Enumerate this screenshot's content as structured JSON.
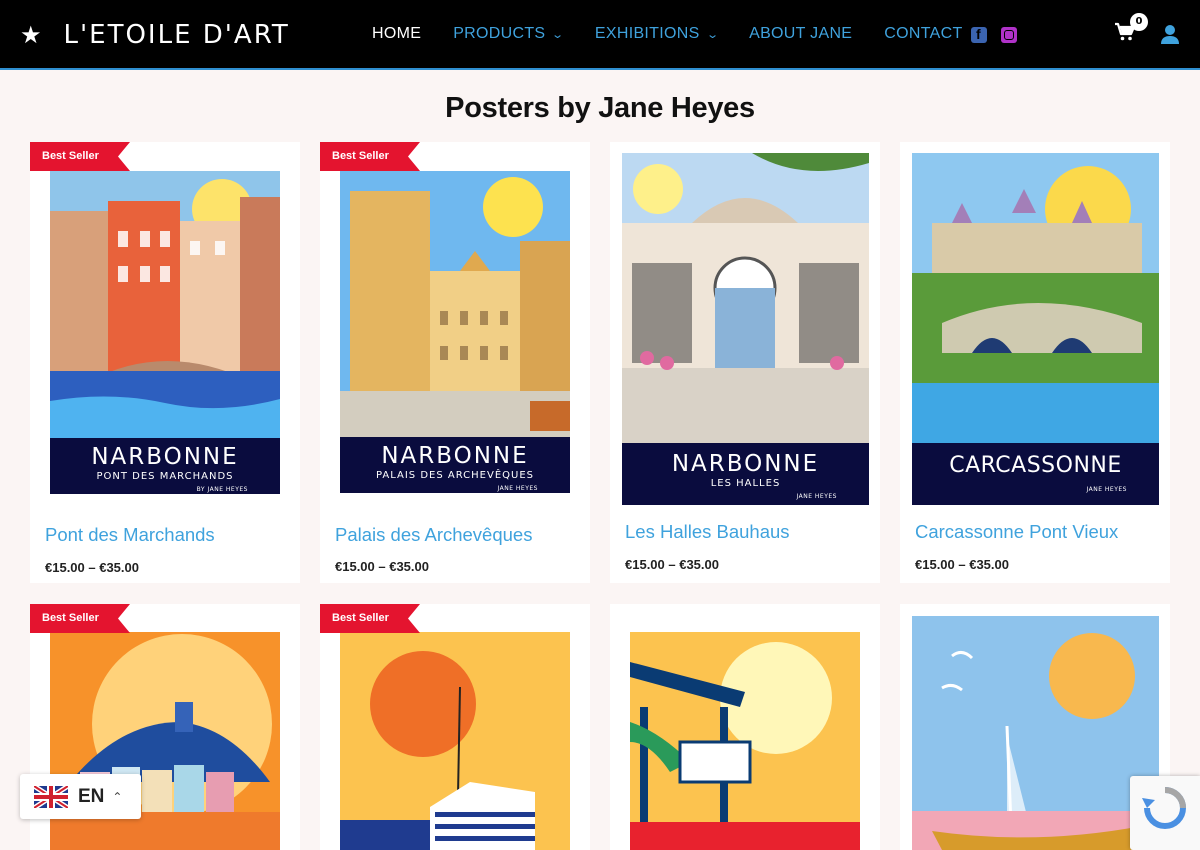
{
  "header": {
    "logo_text": "L'ETOILE D'ART",
    "nav": [
      {
        "label": "HOME",
        "active": true
      },
      {
        "label": "PRODUCTS",
        "dropdown": true
      },
      {
        "label": "EXHIBITIONS",
        "dropdown": true
      },
      {
        "label": "ABOUT JANE"
      },
      {
        "label": "CONTACT"
      }
    ],
    "cart_count": "0",
    "icons": [
      "star-icon",
      "facebook-icon",
      "instagram-icon",
      "cart-icon",
      "user-icon"
    ]
  },
  "page_title": "Posters by Jane Heyes",
  "products": [
    {
      "name": "Pont des Marchands",
      "price": "€15.00 – €35.00",
      "badge": "Best Seller",
      "poster_city": "NARBONNE",
      "poster_sub": "PONT DES MARCHANDS",
      "poster_author": "BY JANE HEYES"
    },
    {
      "name": "Palais des Archevêques",
      "price": "€15.00 – €35.00",
      "badge": "Best Seller",
      "poster_city": "NARBONNE",
      "poster_sub": "PALAIS DES ARCHEVÊQUES",
      "poster_author": "JANE HEYES"
    },
    {
      "name": "Les Halles Bauhaus",
      "price": "€15.00 – €35.00",
      "badge": "",
      "poster_city": "NARBONNE",
      "poster_sub": "LES HALLES",
      "poster_author": "JANE HEYES"
    },
    {
      "name": "Carcassonne Pont Vieux",
      "price": "€15.00 – €35.00",
      "badge": "",
      "poster_city": "CARCASSONNE",
      "poster_sub": "",
      "poster_author": "JANE HEYES"
    },
    {
      "badge": "Best Seller"
    },
    {
      "badge": "Best Seller"
    },
    {
      "badge": ""
    },
    {
      "badge": ""
    }
  ],
  "language": {
    "code": "EN"
  },
  "colors": {
    "accent": "#3fa2dd",
    "badge": "#e4142f",
    "header_bg": "#000000",
    "poster_band": "#0a0c3e"
  }
}
